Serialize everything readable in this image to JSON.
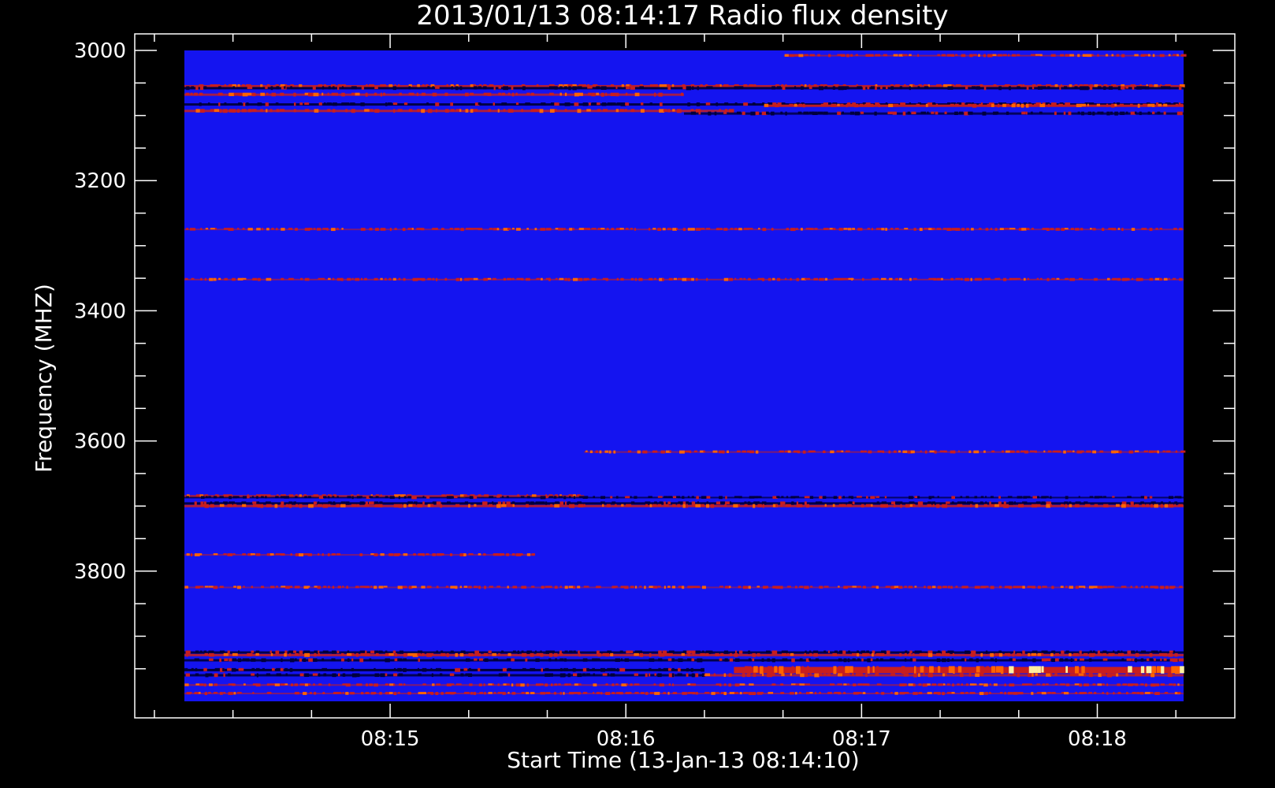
{
  "chart_data": {
    "type": "heatmap",
    "title": "2013/01/13 08:14:17 Radio flux density",
    "xlabel": "Start Time (13-Jan-13 08:14:10)",
    "ylabel": "Frequency (MHZ)",
    "x_range_seconds_after_start": [
      0,
      256
    ],
    "plot_x_range_seconds_after_start": [
      -15,
      265
    ],
    "ylim": [
      3000,
      4000
    ],
    "y_inverted": true,
    "x_ticks": [
      "08:15",
      "08:16",
      "08:17",
      "08:18"
    ],
    "x_tick_seconds_after_start": [
      50,
      110,
      170,
      230
    ],
    "y_ticks": [
      3000,
      3200,
      3400,
      3600,
      3800
    ],
    "y_minor_step": 50,
    "background_color": "#1414f0",
    "colors": {
      "background": "#000000",
      "axes": "#ffffff",
      "low": "#00003c",
      "mid": "#c81e1e",
      "high": "#ff6400",
      "peak": "#fff0a0"
    },
    "bands": [
      {
        "freq": 3008,
        "intensity": 0.35,
        "start_frac": 0.6,
        "end_frac": 1.0,
        "kind": "emission"
      },
      {
        "freq": 3055,
        "intensity": 0.8,
        "start_frac": 0.0,
        "end_frac": 1.0,
        "kind": "emission"
      },
      {
        "freq": 3058,
        "intensity": 0.9,
        "start_frac": 0.0,
        "end_frac": 1.0,
        "kind": "absorption"
      },
      {
        "freq": 3068,
        "intensity": 0.65,
        "start_frac": 0.0,
        "end_frac": 0.5,
        "kind": "emission"
      },
      {
        "freq": 3083,
        "intensity": 0.9,
        "start_frac": 0.0,
        "end_frac": 1.0,
        "kind": "absorption"
      },
      {
        "freq": 3085,
        "intensity": 0.9,
        "start_frac": 0.58,
        "end_frac": 1.0,
        "kind": "emission"
      },
      {
        "freq": 3093,
        "intensity": 0.75,
        "start_frac": 0.0,
        "end_frac": 0.55,
        "kind": "emission"
      },
      {
        "freq": 3097,
        "intensity": 0.7,
        "start_frac": 0.5,
        "end_frac": 1.0,
        "kind": "absorption"
      },
      {
        "freq": 3275,
        "intensity": 0.25,
        "start_frac": 0.0,
        "end_frac": 1.0,
        "kind": "emission"
      },
      {
        "freq": 3352,
        "intensity": 0.4,
        "start_frac": 0.0,
        "end_frac": 1.0,
        "kind": "emission"
      },
      {
        "freq": 3617,
        "intensity": 0.3,
        "start_frac": 0.4,
        "end_frac": 1.0,
        "kind": "emission"
      },
      {
        "freq": 3685,
        "intensity": 0.7,
        "start_frac": 0.0,
        "end_frac": 0.4,
        "kind": "emission"
      },
      {
        "freq": 3687,
        "intensity": 0.6,
        "start_frac": 0.0,
        "end_frac": 1.0,
        "kind": "absorption"
      },
      {
        "freq": 3696,
        "intensity": 0.9,
        "start_frac": 0.0,
        "end_frac": 1.0,
        "kind": "absorption"
      },
      {
        "freq": 3700,
        "intensity": 0.75,
        "start_frac": 0.0,
        "end_frac": 1.0,
        "kind": "emission"
      },
      {
        "freq": 3775,
        "intensity": 0.25,
        "start_frac": 0.0,
        "end_frac": 0.35,
        "kind": "emission"
      },
      {
        "freq": 3825,
        "intensity": 0.2,
        "start_frac": 0.0,
        "end_frac": 1.0,
        "kind": "emission"
      },
      {
        "freq": 3925,
        "intensity": 0.85,
        "start_frac": 0.0,
        "end_frac": 1.0,
        "kind": "absorption"
      },
      {
        "freq": 3929,
        "intensity": 0.75,
        "start_frac": 0.0,
        "end_frac": 1.0,
        "kind": "emission"
      },
      {
        "freq": 3937,
        "intensity": 0.85,
        "start_frac": 0.0,
        "end_frac": 1.0,
        "kind": "absorption"
      },
      {
        "freq": 3952,
        "intensity": 1.0,
        "start_frac": 0.0,
        "end_frac": 0.52,
        "kind": "absorption"
      },
      {
        "freq": 3952,
        "intensity": 1.0,
        "start_frac": 0.55,
        "end_frac": 1.0,
        "kind": "flare"
      },
      {
        "freq": 3960,
        "intensity": 0.8,
        "start_frac": 0.0,
        "end_frac": 0.52,
        "kind": "absorption"
      },
      {
        "freq": 3960,
        "intensity": 0.65,
        "start_frac": 0.52,
        "end_frac": 1.0,
        "kind": "emission"
      },
      {
        "freq": 3975,
        "intensity": 0.35,
        "start_frac": 0.0,
        "end_frac": 1.0,
        "kind": "emission"
      },
      {
        "freq": 3988,
        "intensity": 0.3,
        "start_frac": 0.0,
        "end_frac": 1.0,
        "kind": "emission"
      }
    ]
  }
}
